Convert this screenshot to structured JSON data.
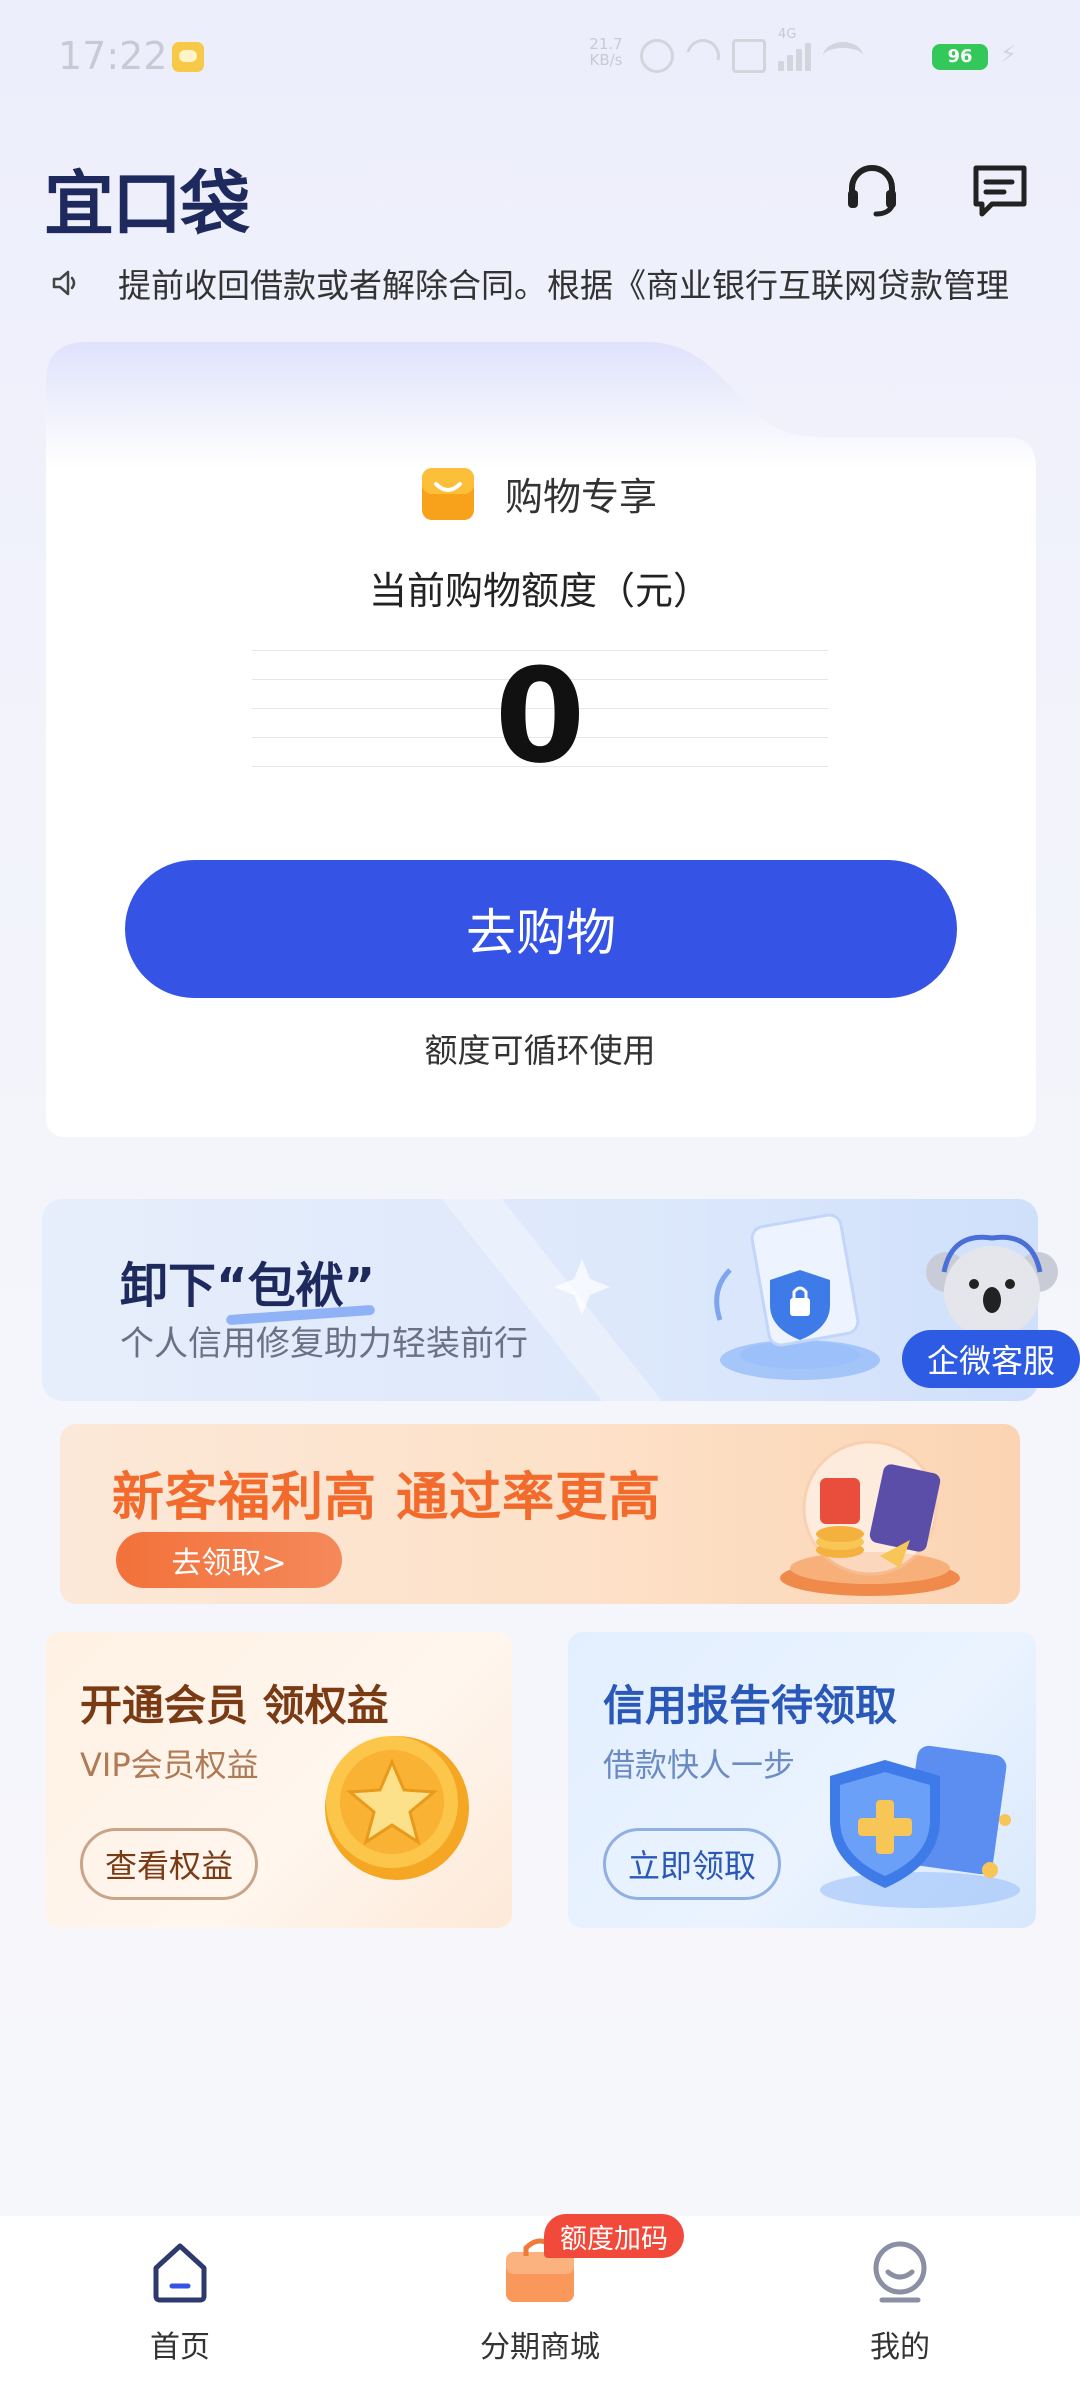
{
  "status_bar": {
    "time": "17:22",
    "net_speed_value": "21.7",
    "net_speed_unit": "KB/s",
    "network": "4G",
    "battery": "96"
  },
  "header": {
    "logo": "宜口袋",
    "icons": [
      "headset-icon",
      "message-icon"
    ]
  },
  "notice": {
    "icon": "speaker-icon",
    "text": "提前收回借款或者解除合同。根据《商业银行互联网贷款管理"
  },
  "shopping_card": {
    "badge": "购物专享",
    "quota_label": "当前购物额度（元）",
    "quota_value": "0",
    "button": "去购物",
    "note": "额度可循环使用"
  },
  "repair_banner": {
    "title_prefix": "卸下",
    "title_highlight": "“包袱”",
    "subtitle": "个人信用修复助力轻装前行",
    "service_button": "企微客服"
  },
  "newbie_banner": {
    "title": "新客福利高 通过率更高",
    "button": "去领取>"
  },
  "vip_card": {
    "title": "开通会员 领权益",
    "subtitle": "VIP会员权益",
    "button": "查看权益"
  },
  "credit_card": {
    "title": "信用报告待领取",
    "subtitle": "借款快人一步",
    "button": "立即领取"
  },
  "bottom_nav": {
    "home": "首页",
    "mall": "分期商城",
    "mall_badge": "额度加码",
    "mine": "我的"
  },
  "colors": {
    "primary": "#3554e6",
    "logo": "#1e2a5e",
    "orange": "#f26a2c",
    "badge_red": "#f24a3a"
  }
}
